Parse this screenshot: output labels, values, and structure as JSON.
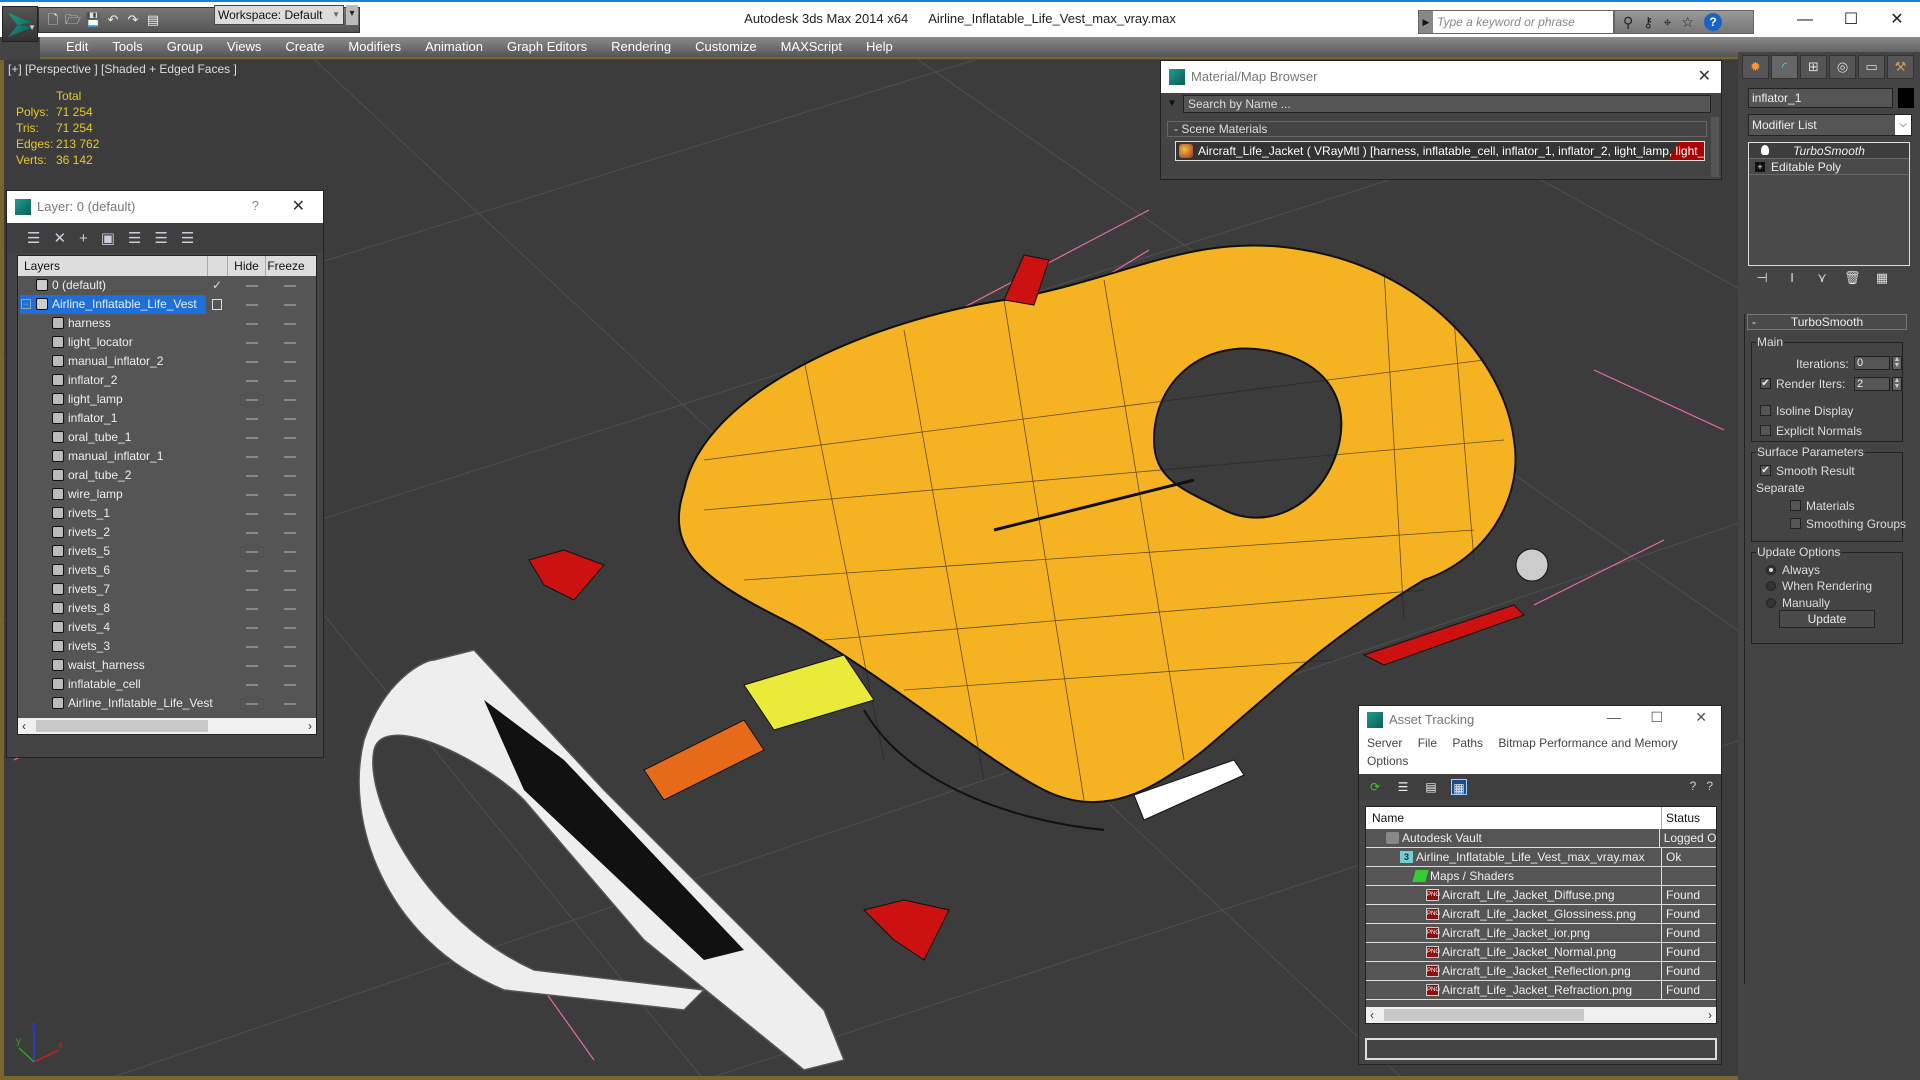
{
  "app": {
    "title": "Autodesk 3ds Max  2014 x64",
    "file": "Airline_Inflatable_Life_Vest_max_vray.max",
    "workspace": "Workspace: Default",
    "search_placeholder": "Type a keyword or phrase"
  },
  "menu": [
    "Edit",
    "Tools",
    "Group",
    "Views",
    "Create",
    "Modifiers",
    "Animation",
    "Graph Editors",
    "Rendering",
    "Customize",
    "MAXScript",
    "Help"
  ],
  "viewport": {
    "label": "[+] [Perspective ] [Shaded + Edged Faces ]",
    "stats": {
      "header": "Total",
      "rows": [
        {
          "k": "Polys:",
          "v": "71 254"
        },
        {
          "k": "Tris:",
          "v": "71 254"
        },
        {
          "k": "Edges:",
          "v": "213 762"
        },
        {
          "k": "Verts:",
          "v": "36 142"
        }
      ]
    },
    "axis": {
      "x": "x",
      "y": "y",
      "z": "z"
    },
    "colors": {
      "vest": "#f5b323",
      "inflator": "#cc1111",
      "harness": "#e8e8e8",
      "grid": "#4f4f4f",
      "background": "#3c3c3c"
    }
  },
  "layer_panel": {
    "title": "Layer: 0 (default)",
    "help": "?",
    "columns": {
      "layers": "Layers",
      "hide": "Hide",
      "freeze": "Freeze"
    },
    "rows": [
      {
        "name": "0 (default)",
        "level": 0,
        "current": true
      },
      {
        "name": "Airline_Inflatable_Life_Vest",
        "level": 0,
        "selected": true
      },
      {
        "name": "harness",
        "level": 1
      },
      {
        "name": "light_locator",
        "level": 1
      },
      {
        "name": "manual_inflator_2",
        "level": 1
      },
      {
        "name": "inflator_2",
        "level": 1
      },
      {
        "name": "light_lamp",
        "level": 1
      },
      {
        "name": "inflator_1",
        "level": 1
      },
      {
        "name": "oral_tube_1",
        "level": 1
      },
      {
        "name": "manual_inflator_1",
        "level": 1
      },
      {
        "name": "oral_tube_2",
        "level": 1
      },
      {
        "name": "wire_lamp",
        "level": 1
      },
      {
        "name": "rivets_1",
        "level": 1
      },
      {
        "name": "rivets_2",
        "level": 1
      },
      {
        "name": "rivets_5",
        "level": 1
      },
      {
        "name": "rivets_6",
        "level": 1
      },
      {
        "name": "rivets_7",
        "level": 1
      },
      {
        "name": "rivets_8",
        "level": 1
      },
      {
        "name": "rivets_4",
        "level": 1
      },
      {
        "name": "rivets_3",
        "level": 1
      },
      {
        "name": "waist_harness",
        "level": 1
      },
      {
        "name": "inflatable_cell",
        "level": 1
      },
      {
        "name": "Airline_Inflatable_Life_Vest",
        "level": 1
      }
    ]
  },
  "material_browser": {
    "title": "Material/Map Browser",
    "search_placeholder": "Search by Name ...",
    "section": "- Scene Materials",
    "item": "Aircraft_Life_Jacket ( VRayMtl ) [harness, inflatable_cell, inflator_1, inflator_2, light_lamp, light_l..."
  },
  "command_panel": {
    "object_name": "inflator_1",
    "modifier_list": "Modifier List",
    "stack": [
      "TurboSmooth",
      "Editable Poly"
    ],
    "turbosmooth": {
      "header": "TurboSmooth",
      "main_label": "Main",
      "iterations_label": "Iterations:",
      "iterations": "0",
      "render_iters_label": "Render Iters:",
      "render_iters": "2",
      "render_iters_checked": true,
      "isoline_label": "Isoline Display",
      "isoline_checked": false,
      "explicit_normals_label": "Explicit Normals",
      "explicit_normals_checked": false,
      "surface_label": "Surface Parameters",
      "smooth_result_label": "Smooth Result",
      "smooth_result_checked": true,
      "separate_label": "Separate",
      "materials_label": "Materials",
      "smoothing_groups_label": "Smoothing Groups",
      "update_options_label": "Update Options",
      "always_label": "Always",
      "when_rendering_label": "When Rendering",
      "manually_label": "Manually",
      "update_mode": "Always",
      "update_button": "Update"
    }
  },
  "asset_tracking": {
    "title": "Asset Tracking",
    "menu": [
      "Server",
      "File",
      "Paths",
      "Bitmap Performance and Memory",
      "Options"
    ],
    "columns": {
      "name": "Name",
      "status": "Status"
    },
    "rows": [
      {
        "name": "Autodesk Vault",
        "status": "Logged O",
        "icon": "vault",
        "indent": 1
      },
      {
        "name": "Airline_Inflatable_Life_Vest_max_vray.max",
        "status": "Ok",
        "icon": "max",
        "indent": 2
      },
      {
        "name": "Maps / Shaders",
        "status": "",
        "icon": "maps",
        "indent": 3
      },
      {
        "name": "Aircraft_Life_Jacket_Diffuse.png",
        "status": "Found",
        "icon": "png",
        "indent": 4
      },
      {
        "name": "Aircraft_Life_Jacket_Glossiness.png",
        "status": "Found",
        "icon": "png",
        "indent": 4
      },
      {
        "name": "Aircraft_Life_Jacket_ior.png",
        "status": "Found",
        "icon": "png",
        "indent": 4
      },
      {
        "name": "Aircraft_Life_Jacket_Normal.png",
        "status": "Found",
        "icon": "png",
        "indent": 4
      },
      {
        "name": "Aircraft_Life_Jacket_Reflection.png",
        "status": "Found",
        "icon": "png",
        "indent": 4
      },
      {
        "name": "Aircraft_Life_Jacket_Refraction.png",
        "status": "Found",
        "icon": "png",
        "indent": 4
      }
    ]
  }
}
